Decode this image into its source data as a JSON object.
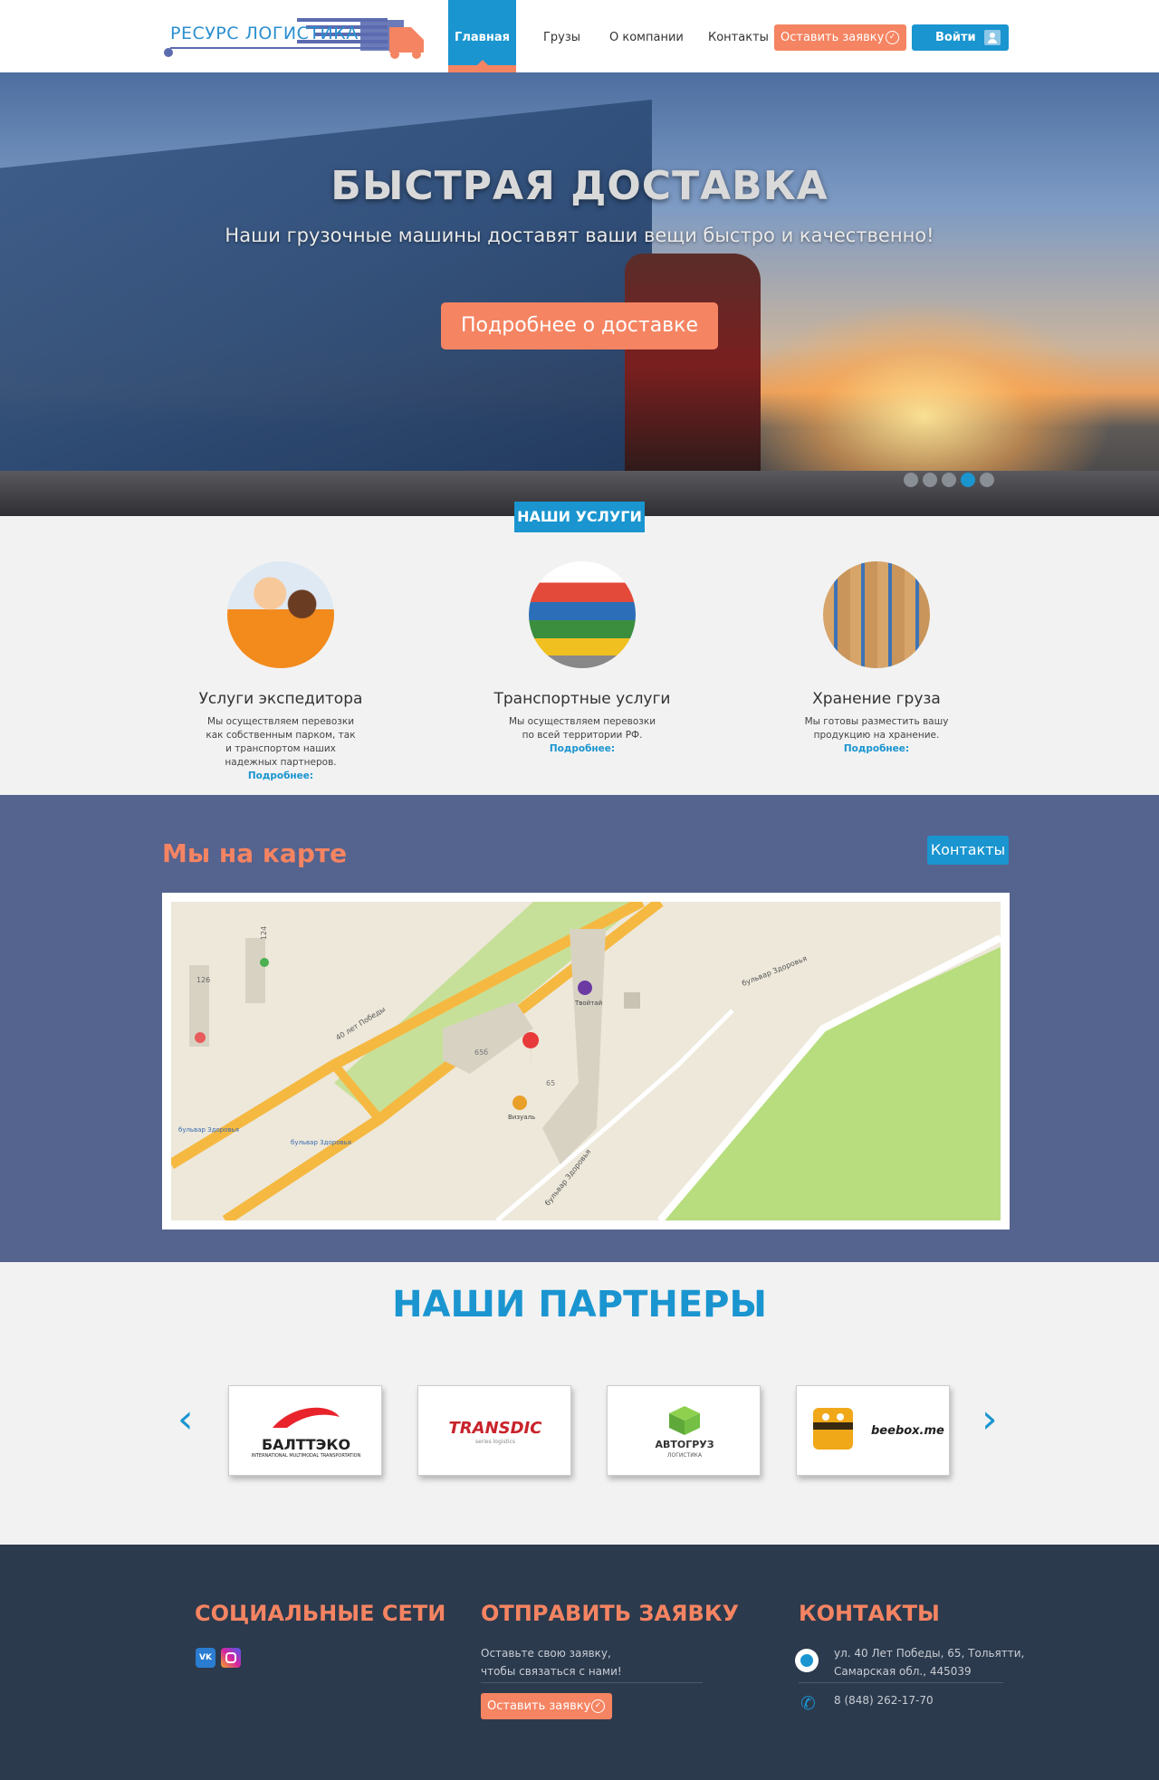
{
  "header": {
    "logo_text": "РЕСУРС ЛОГИСТИКА",
    "nav": [
      "Главная",
      "Грузы",
      "О компании",
      "Контакты"
    ],
    "order_button": "Оставить заявку",
    "login_button": "Войти"
  },
  "hero": {
    "title": "БЫСТРАЯ ДОСТАВКА",
    "subtitle": "Наши грузочные машины доставят ваши вещи быстро и качественно!",
    "button": "Подробнее о доставке",
    "slides_total": 5,
    "active_slide": 4
  },
  "services": {
    "tab": "НАШИ УСЛУГИ",
    "items": [
      {
        "title": "Услуги экспедитора",
        "desc": "Мы осуществляем перевозки как собственным парком, так и транспортом наших надежных партнеров.",
        "more": "Подробнее:"
      },
      {
        "title": "Транспортные услуги",
        "desc": "Мы осуществляем перевозки по всей территории РФ.",
        "more": "Подробнее:"
      },
      {
        "title": "Хранение груза",
        "desc": "Мы готовы разместить вашу продукцию на хранение.",
        "more": "Подробнее:"
      }
    ]
  },
  "map": {
    "title": "Мы на карте",
    "contacts_button": "Контакты",
    "labels": {
      "street1": "40 лет Победы",
      "street2": "бульвар Здоровья",
      "street3": "бульвар Здоровья",
      "stop1": "бульвар Здоровья",
      "stop2": "бульвар Здоровья",
      "b124": "124",
      "b126": "126",
      "b65b": "65б",
      "b65": "65",
      "poi1": "Твойтай",
      "poi2": "Визуаль"
    }
  },
  "partners": {
    "title": "НАШИ ПАРТНЕРЫ",
    "prev": "‹",
    "next": "›",
    "logos": [
      {
        "name": "БАЛТТЭКО",
        "sub": "INTERNATIONAL MULTIMODAL TRANSPORTATION"
      },
      {
        "name": "TRANSDIC",
        "sub": "series logistics"
      },
      {
        "name": "АВТОГРУЗ",
        "sub": "ЛОГИСТИКА"
      },
      {
        "name": "beebox.me",
        "sub": ""
      }
    ]
  },
  "footer": {
    "social_title": "СОЦИАЛЬНЫЕ СЕТИ",
    "order_title": "ОТПРАВИТЬ ЗАЯВКУ",
    "order_text_1": "Оставьте свою заявку,",
    "order_text_2": "чтобы связаться с нами!",
    "order_button": "Оставить заявку",
    "contacts_title": "КОНТАКТЫ",
    "address_1": "ул. 40 Лет Победы, 65, Тольятти,",
    "address_2": "Самарская обл., 445039",
    "phone": "8 (848) 262-17-70",
    "vk": "VK"
  },
  "colors": {
    "accent": "#f58462",
    "brand": "#1a95d0",
    "map_bg": "#55638f",
    "footer_bg": "#2c3a4d"
  }
}
